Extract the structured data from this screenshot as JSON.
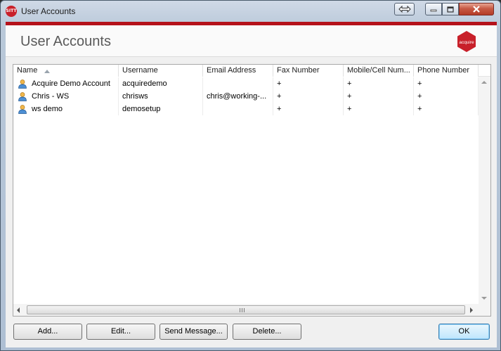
{
  "window": {
    "title": "User Accounts",
    "app_icon_text": "SITT"
  },
  "header": {
    "title": "User Accounts",
    "logo_text": "acquire"
  },
  "table": {
    "columns": [
      "Name",
      "Username",
      "Email Address",
      "Fax Number",
      "Mobile/Cell Num...",
      "Phone Number"
    ],
    "sort_column": "Name",
    "rows": [
      {
        "name": "Acquire Demo Account",
        "username": "acquiredemo",
        "email": "",
        "fax": "+",
        "mobile": "+",
        "phone": "+"
      },
      {
        "name": "Chris - WS",
        "username": "chrisws",
        "email": "chris@working-...",
        "fax": "+",
        "mobile": "+",
        "phone": "+"
      },
      {
        "name": "ws demo",
        "username": "demosetup",
        "email": "",
        "fax": "+",
        "mobile": "+",
        "phone": "+"
      }
    ]
  },
  "buttons": {
    "add": "Add...",
    "edit": "Edit...",
    "send_message": "Send Message...",
    "delete": "Delete...",
    "ok": "OK"
  },
  "icons": {
    "user": "user-icon",
    "close": "close-icon",
    "minimize": "minimize-icon",
    "maximize": "maximize-icon",
    "resize": "resize-icon"
  },
  "colors": {
    "brand_red": "#b5121b",
    "ok_accent": "#3c7fb1"
  }
}
